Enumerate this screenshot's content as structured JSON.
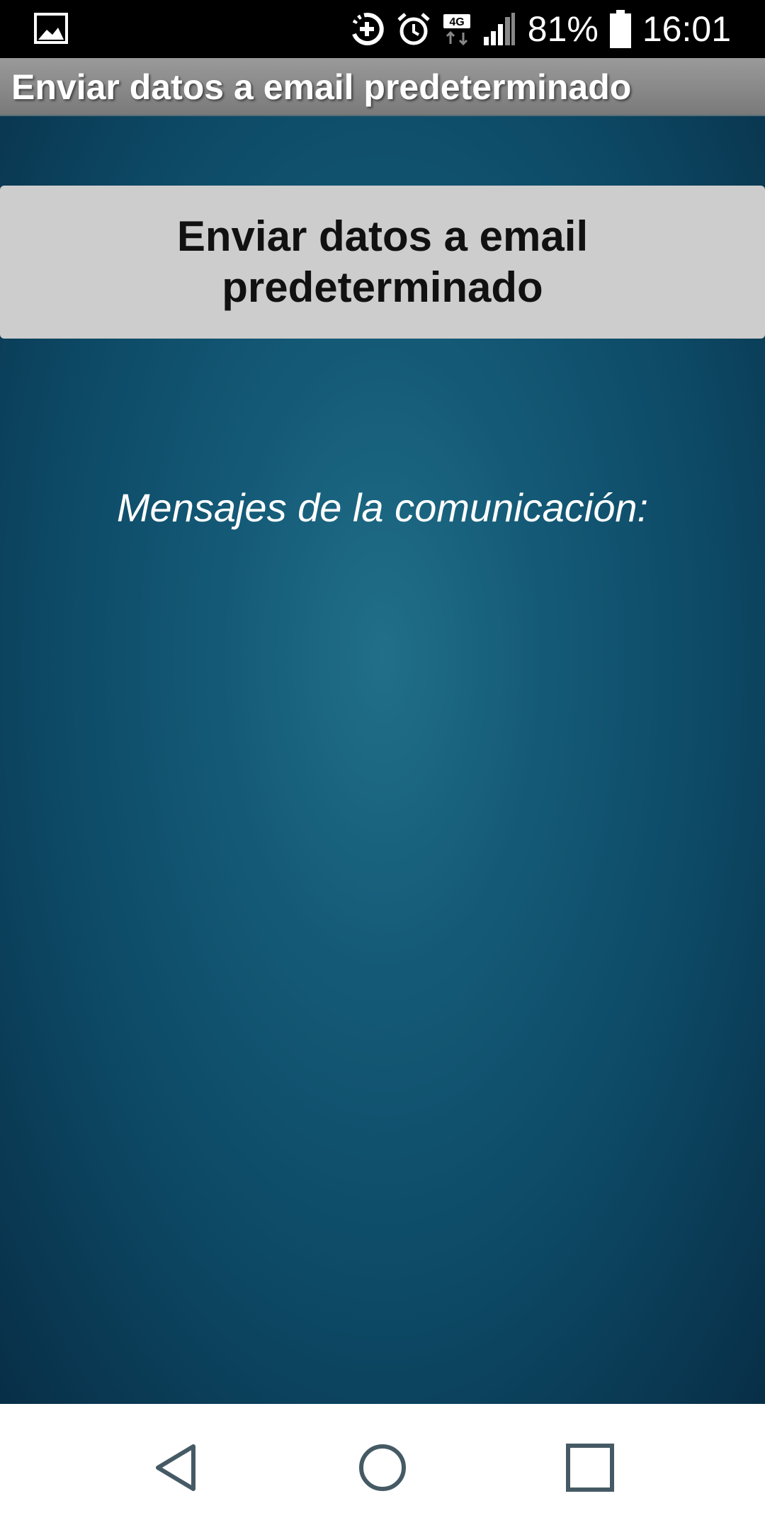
{
  "status_bar": {
    "battery_percent": "81%",
    "time": "16:01",
    "network_type": "4G",
    "icons": [
      "gallery-icon",
      "data-saver-icon",
      "alarm-icon",
      "network-4g-icon",
      "signal-icon",
      "battery-icon"
    ]
  },
  "app_bar": {
    "title": "Enviar datos a email predeterminado"
  },
  "main": {
    "send_button_label": "Enviar datos a email predeterminado",
    "messages_label": "Mensajes de la comunicación:"
  },
  "nav_bar": {
    "icons": [
      "back-icon",
      "home-icon",
      "recents-icon"
    ]
  },
  "colors": {
    "title_bar": "#8a8a8a",
    "button_bg": "#cdcdcd",
    "content_bg": "#145a77",
    "status_bar": "#000000",
    "nav_bar": "#ffffff"
  }
}
